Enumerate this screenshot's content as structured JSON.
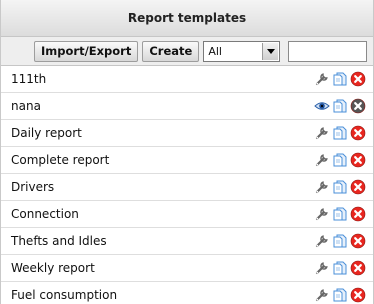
{
  "panel": {
    "title": "Report templates"
  },
  "toolbar": {
    "import_export_label": "Import/Export",
    "create_label": "Create",
    "filter_value": "All",
    "search_value": ""
  },
  "templates": [
    {
      "name": "111th",
      "first_icon": "wrench-icon",
      "delete_style": "red"
    },
    {
      "name": "nana",
      "first_icon": "eye-icon",
      "delete_style": "gray"
    },
    {
      "name": "Daily report",
      "first_icon": "wrench-icon",
      "delete_style": "red"
    },
    {
      "name": "Complete report",
      "first_icon": "wrench-icon",
      "delete_style": "red"
    },
    {
      "name": "Drivers",
      "first_icon": "wrench-icon",
      "delete_style": "red"
    },
    {
      "name": "Connection",
      "first_icon": "wrench-icon",
      "delete_style": "red"
    },
    {
      "name": "Thefts and Idles",
      "first_icon": "wrench-icon",
      "delete_style": "red"
    },
    {
      "name": "Weekly report",
      "first_icon": "wrench-icon",
      "delete_style": "red"
    },
    {
      "name": "Fuel consumption",
      "first_icon": "wrench-icon",
      "delete_style": "red"
    }
  ],
  "colors": {
    "delete_red": "#e8261f",
    "delete_gray": "#555555",
    "copy_blue": "#4a8fd8"
  }
}
